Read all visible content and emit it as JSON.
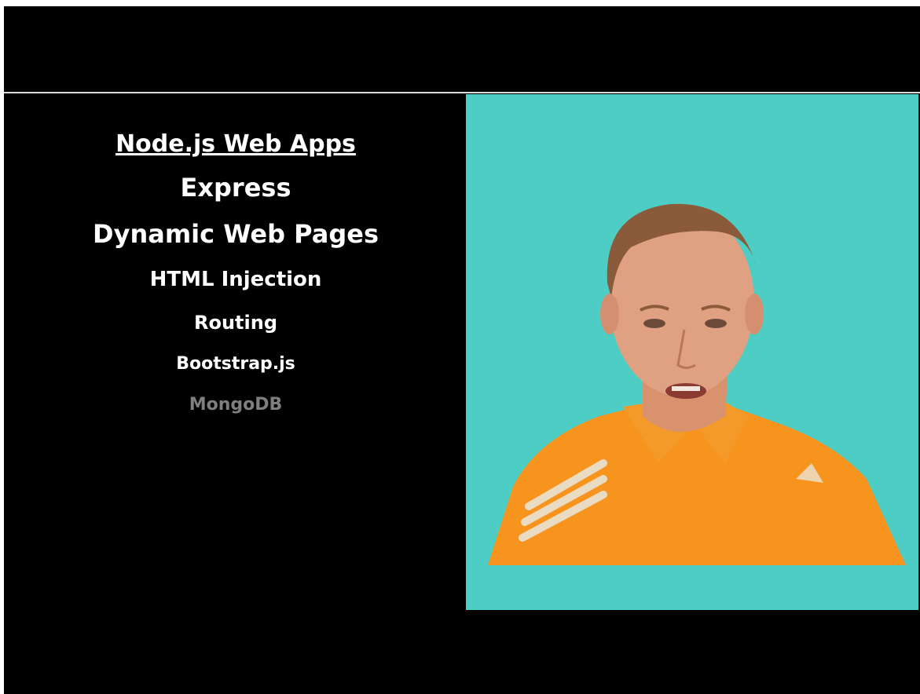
{
  "slide": {
    "title": "Node.js Web Apps",
    "topics": [
      "Express",
      "Dynamic Web Pages",
      "HTML Injection",
      "Routing",
      "Bootstrap.js",
      "MongoDB"
    ]
  },
  "colors": {
    "background": "#000000",
    "text": "#ffffff",
    "dimmed_text": "#7f7f7f",
    "video_background": "#4ecdc4",
    "shirt": "#f7941d"
  },
  "video": {
    "subject": "presenter-in-orange-shirt"
  }
}
